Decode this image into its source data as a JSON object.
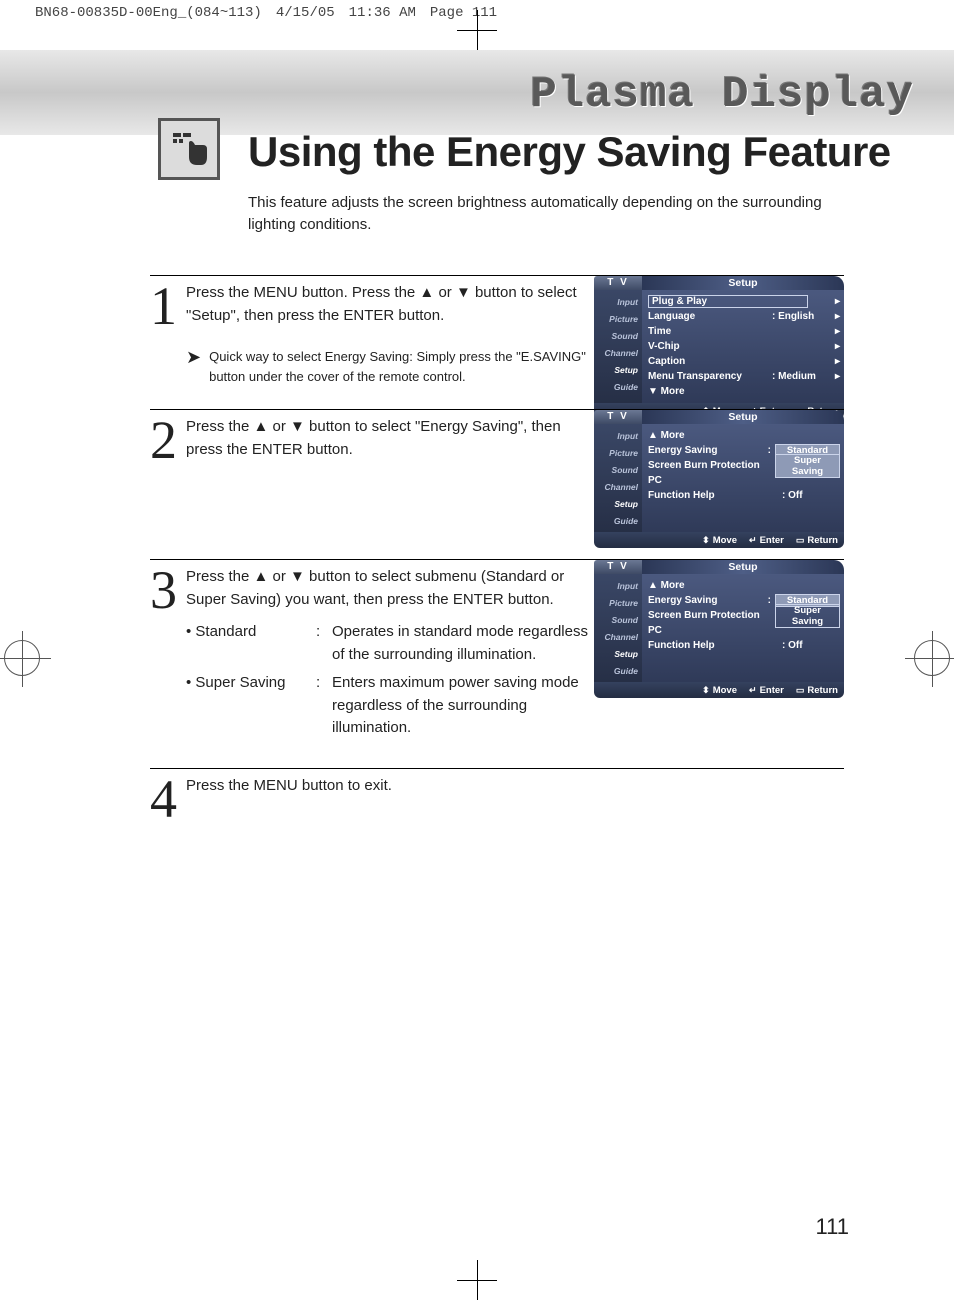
{
  "print_header": {
    "doc": "BN68-00835D-00Eng_(084~113)",
    "date": "4/15/05",
    "time": "11:36 AM",
    "page": "Page 111"
  },
  "banner_title": "Plasma Display",
  "page_title": "Using the Energy Saving Feature",
  "page_subtitle": "This feature adjusts the screen brightness automatically depending on the surrounding lighting conditions.",
  "steps": [
    {
      "num": "1",
      "text": "Press the MENU button. Press the ▲ or ▼ button to select \"Setup\", then press the ENTER button.",
      "tip": "Quick way to select Energy Saving: Simply press the \"E.SAVING\" button under the cover of the remote control."
    },
    {
      "num": "2",
      "text": "Press the ▲ or ▼ button to select \"Energy Saving\", then press the ENTER button."
    },
    {
      "num": "3",
      "text": "Press the ▲ or ▼ button to select submenu (Standard or Super Saving) you want, then press the ENTER button.",
      "bullets": [
        {
          "label": "• Standard",
          "desc": "Operates in standard mode regardless of the surrounding illumination."
        },
        {
          "label": "• Super Saving",
          "desc": "Enters maximum power saving mode regardless of the surrounding illumination."
        }
      ]
    },
    {
      "num": "4",
      "text": "Press the MENU button to exit."
    }
  ],
  "osd_common": {
    "tv": "T V",
    "title": "Setup",
    "side": [
      "Input",
      "Picture",
      "Sound",
      "Channel",
      "Setup",
      "Guide"
    ],
    "footer": {
      "move": "Move",
      "enter": "Enter",
      "return": "Return"
    }
  },
  "osd1_rows": [
    {
      "label": "Plug & Play",
      "boxed": true
    },
    {
      "label": "Language",
      "val": ": English",
      "arrow": true
    },
    {
      "label": "Time",
      "arrow": true
    },
    {
      "label": "V-Chip",
      "arrow": true
    },
    {
      "label": "Caption",
      "arrow": true
    },
    {
      "label": "Menu Transparency",
      "val": ": Medium",
      "arrow": true
    },
    {
      "label": "▼ More"
    }
  ],
  "osd23_rows": {
    "more": "▲ More",
    "energy": "Energy Saving",
    "burn": "Screen Burn Protection",
    "pc": "PC",
    "help": "Function Help",
    "help_val": ": Off",
    "opt1": "Standard",
    "opt2": "Super Saving",
    "colon": ":"
  },
  "page_num": "111"
}
